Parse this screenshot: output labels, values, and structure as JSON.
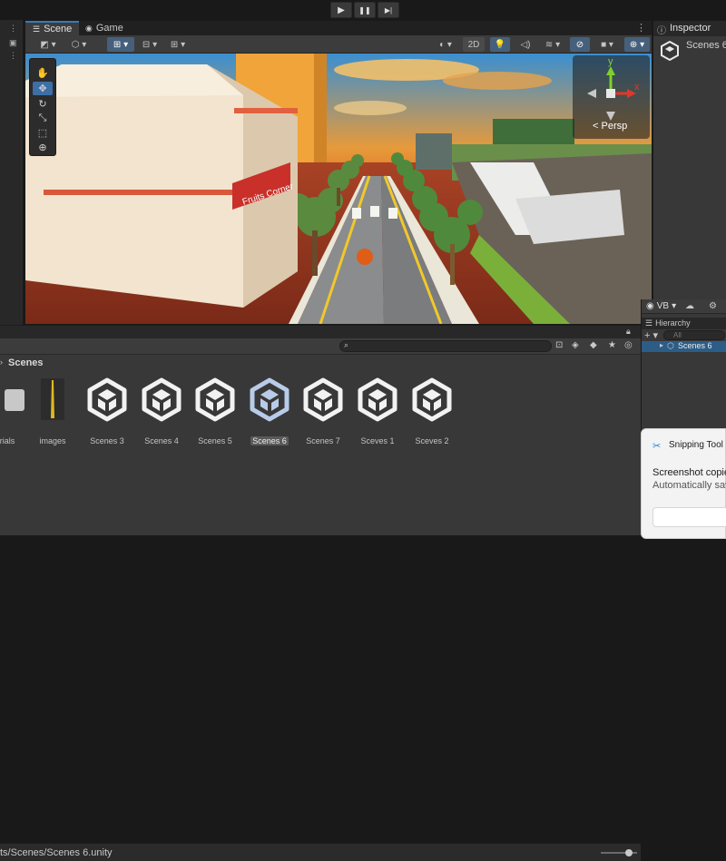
{
  "toolbar": {
    "play_icon": "▶",
    "pause_icon": "❚❚",
    "step_icon": "▶|"
  },
  "scene_tabs": [
    {
      "label": "Scene",
      "icon": "scene-icon"
    },
    {
      "label": "Game",
      "icon": "game-icon"
    }
  ],
  "scene_toolbar": {
    "mode_2d": "2D"
  },
  "viewport": {
    "sign_text": "Fruits Corner"
  },
  "gizmo": {
    "persp_label": "Persp",
    "x_axis": "x",
    "y_axis": "y"
  },
  "inspector": {
    "tab_label": "Inspector",
    "object_name": "Scenes 6"
  },
  "account": {
    "label": "VB"
  },
  "hierarchy": {
    "tab_label": "Hierarchy",
    "search_placeholder": "All",
    "item": "Scenes 6"
  },
  "project": {
    "breadcrumb": "Scenes",
    "assets": [
      {
        "label": "rials",
        "type": "folder"
      },
      {
        "label": "images",
        "type": "texture"
      },
      {
        "label": "Scenes 3",
        "type": "scene"
      },
      {
        "label": "Scenes 4",
        "type": "scene"
      },
      {
        "label": "Scenes 5",
        "type": "scene"
      },
      {
        "label": "Scenes 6",
        "type": "scene",
        "selected": true
      },
      {
        "label": "Scenes 7",
        "type": "scene"
      },
      {
        "label": "Sceves 1",
        "type": "scene"
      },
      {
        "label": "Sceves 2",
        "type": "scene"
      }
    ],
    "status_path": "ts/Scenes/Scenes 6.unity",
    "zoom_slider_level": 0.83
  },
  "snipping": {
    "app_name": "Snipping Tool",
    "title": "Screenshot copie",
    "subtitle": "Automatically sav"
  },
  "colors": {
    "accent": "#3a79bb",
    "panel": "#383838",
    "dark": "#191919"
  }
}
